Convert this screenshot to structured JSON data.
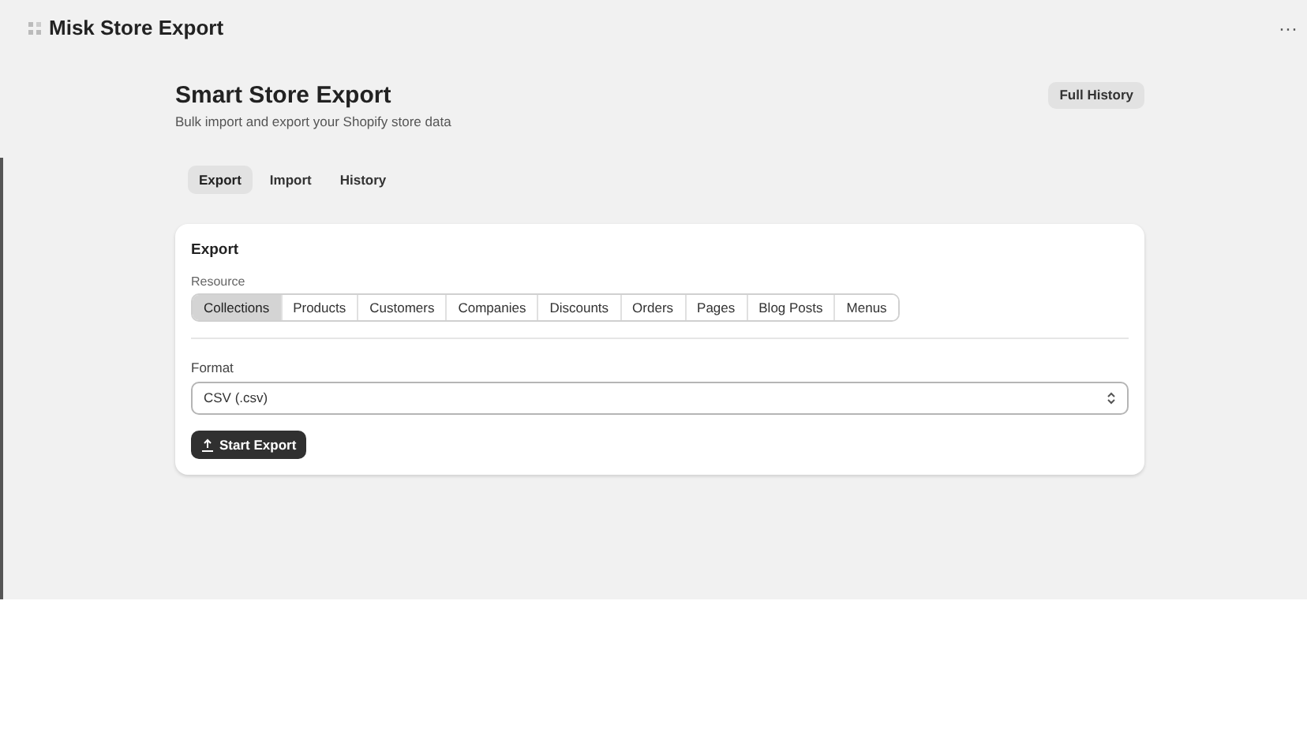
{
  "app": {
    "title": "Misk Store Export",
    "menu": "···"
  },
  "header": {
    "title": "Smart Store Export",
    "subtitle": "Bulk import and export your Shopify store data",
    "action": "Full History"
  },
  "tabs": [
    {
      "label": "Export",
      "selected": true
    },
    {
      "label": "Import",
      "selected": false
    },
    {
      "label": "History",
      "selected": false
    }
  ],
  "card": {
    "title": "Export",
    "resource_label": "Resource",
    "resources": [
      {
        "label": "Collections",
        "selected": true
      },
      {
        "label": "Products",
        "selected": false
      },
      {
        "label": "Customers",
        "selected": false
      },
      {
        "label": "Companies",
        "selected": false
      },
      {
        "label": "Discounts",
        "selected": false
      },
      {
        "label": "Orders",
        "selected": false
      },
      {
        "label": "Pages",
        "selected": false
      },
      {
        "label": "Blog Posts",
        "selected": false
      },
      {
        "label": "Menus",
        "selected": false
      }
    ],
    "format_label": "Format",
    "format_value": "CSV (.csv)",
    "button": "Start Export"
  }
}
